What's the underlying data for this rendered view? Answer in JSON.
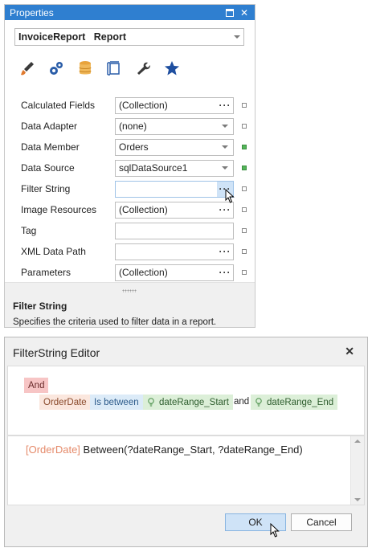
{
  "properties": {
    "title": "Properties",
    "object_name": "InvoiceReport   Report",
    "tabs": [
      {
        "icon": "brush-icon"
      },
      {
        "icon": "gears-icon"
      },
      {
        "icon": "database-icon"
      },
      {
        "icon": "layout-icon"
      },
      {
        "icon": "wrench-icon"
      },
      {
        "icon": "star-icon"
      }
    ],
    "rows": [
      {
        "label": "Calculated Fields",
        "value": "(Collection)",
        "editor": "dots",
        "mark": "empty"
      },
      {
        "label": "Data Adapter",
        "value": "(none)",
        "editor": "dropdown",
        "mark": "empty"
      },
      {
        "label": "Data Member",
        "value": "Orders",
        "editor": "dropdown",
        "mark": "green"
      },
      {
        "label": "Data Source",
        "value": "sqlDataSource1",
        "editor": "dropdown",
        "mark": "green"
      },
      {
        "label": "Filter String",
        "value": "",
        "editor": "dots-hot",
        "mark": "empty"
      },
      {
        "label": "Image Resources",
        "value": "(Collection)",
        "editor": "dots",
        "mark": "empty"
      },
      {
        "label": "Tag",
        "value": "",
        "editor": "none",
        "mark": "empty"
      },
      {
        "label": "XML Data Path",
        "value": "",
        "editor": "dots",
        "mark": "empty"
      },
      {
        "label": "Parameters",
        "value": "(Collection)",
        "editor": "dots",
        "mark": "empty"
      }
    ],
    "description_title": "Filter String",
    "description_text": "Specifies the criteria used to filter data in a report."
  },
  "editor": {
    "title": "FilterString Editor",
    "group": "And",
    "condition": {
      "field": "OrderDate",
      "operator": "Is between",
      "param1": "dateRange_Start",
      "conj": "and",
      "param2": "dateRange_End"
    },
    "expression_field": "[OrderDate]",
    "expression_rest": " Between(?dateRange_Start, ?dateRange_End)",
    "ok_label": "OK",
    "cancel_label": "Cancel"
  },
  "colors": {
    "titlebar": "#2f7fd0",
    "and_chip": "#f7c5c5",
    "field_chip": "#fbe7de",
    "op_chip": "#dcebf8",
    "param_chip": "#dcefd8"
  }
}
